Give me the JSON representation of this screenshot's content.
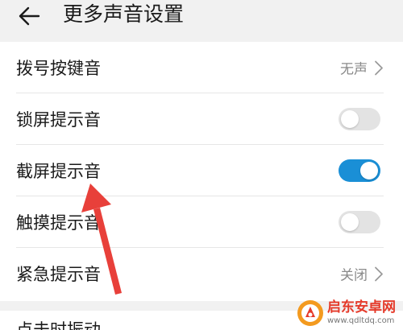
{
  "header": {
    "title": "更多声音设置"
  },
  "settings": [
    {
      "label": "拨号按键音",
      "value": "无声"
    },
    {
      "label": "锁屏提示音",
      "toggle": "off"
    },
    {
      "label": "截屏提示音",
      "toggle": "on"
    },
    {
      "label": "触摸提示音",
      "toggle": "off"
    },
    {
      "label": "紧急提示音",
      "value": "关闭"
    }
  ],
  "next_section": {
    "label": "点击时振动"
  },
  "watermark": {
    "name": "启东安卓网",
    "url": "www.qdltdq.com"
  },
  "colors": {
    "accent": "#1a8fd6",
    "toggle_off": "#e3e3e3",
    "annotation_arrow": "#e8403a"
  }
}
